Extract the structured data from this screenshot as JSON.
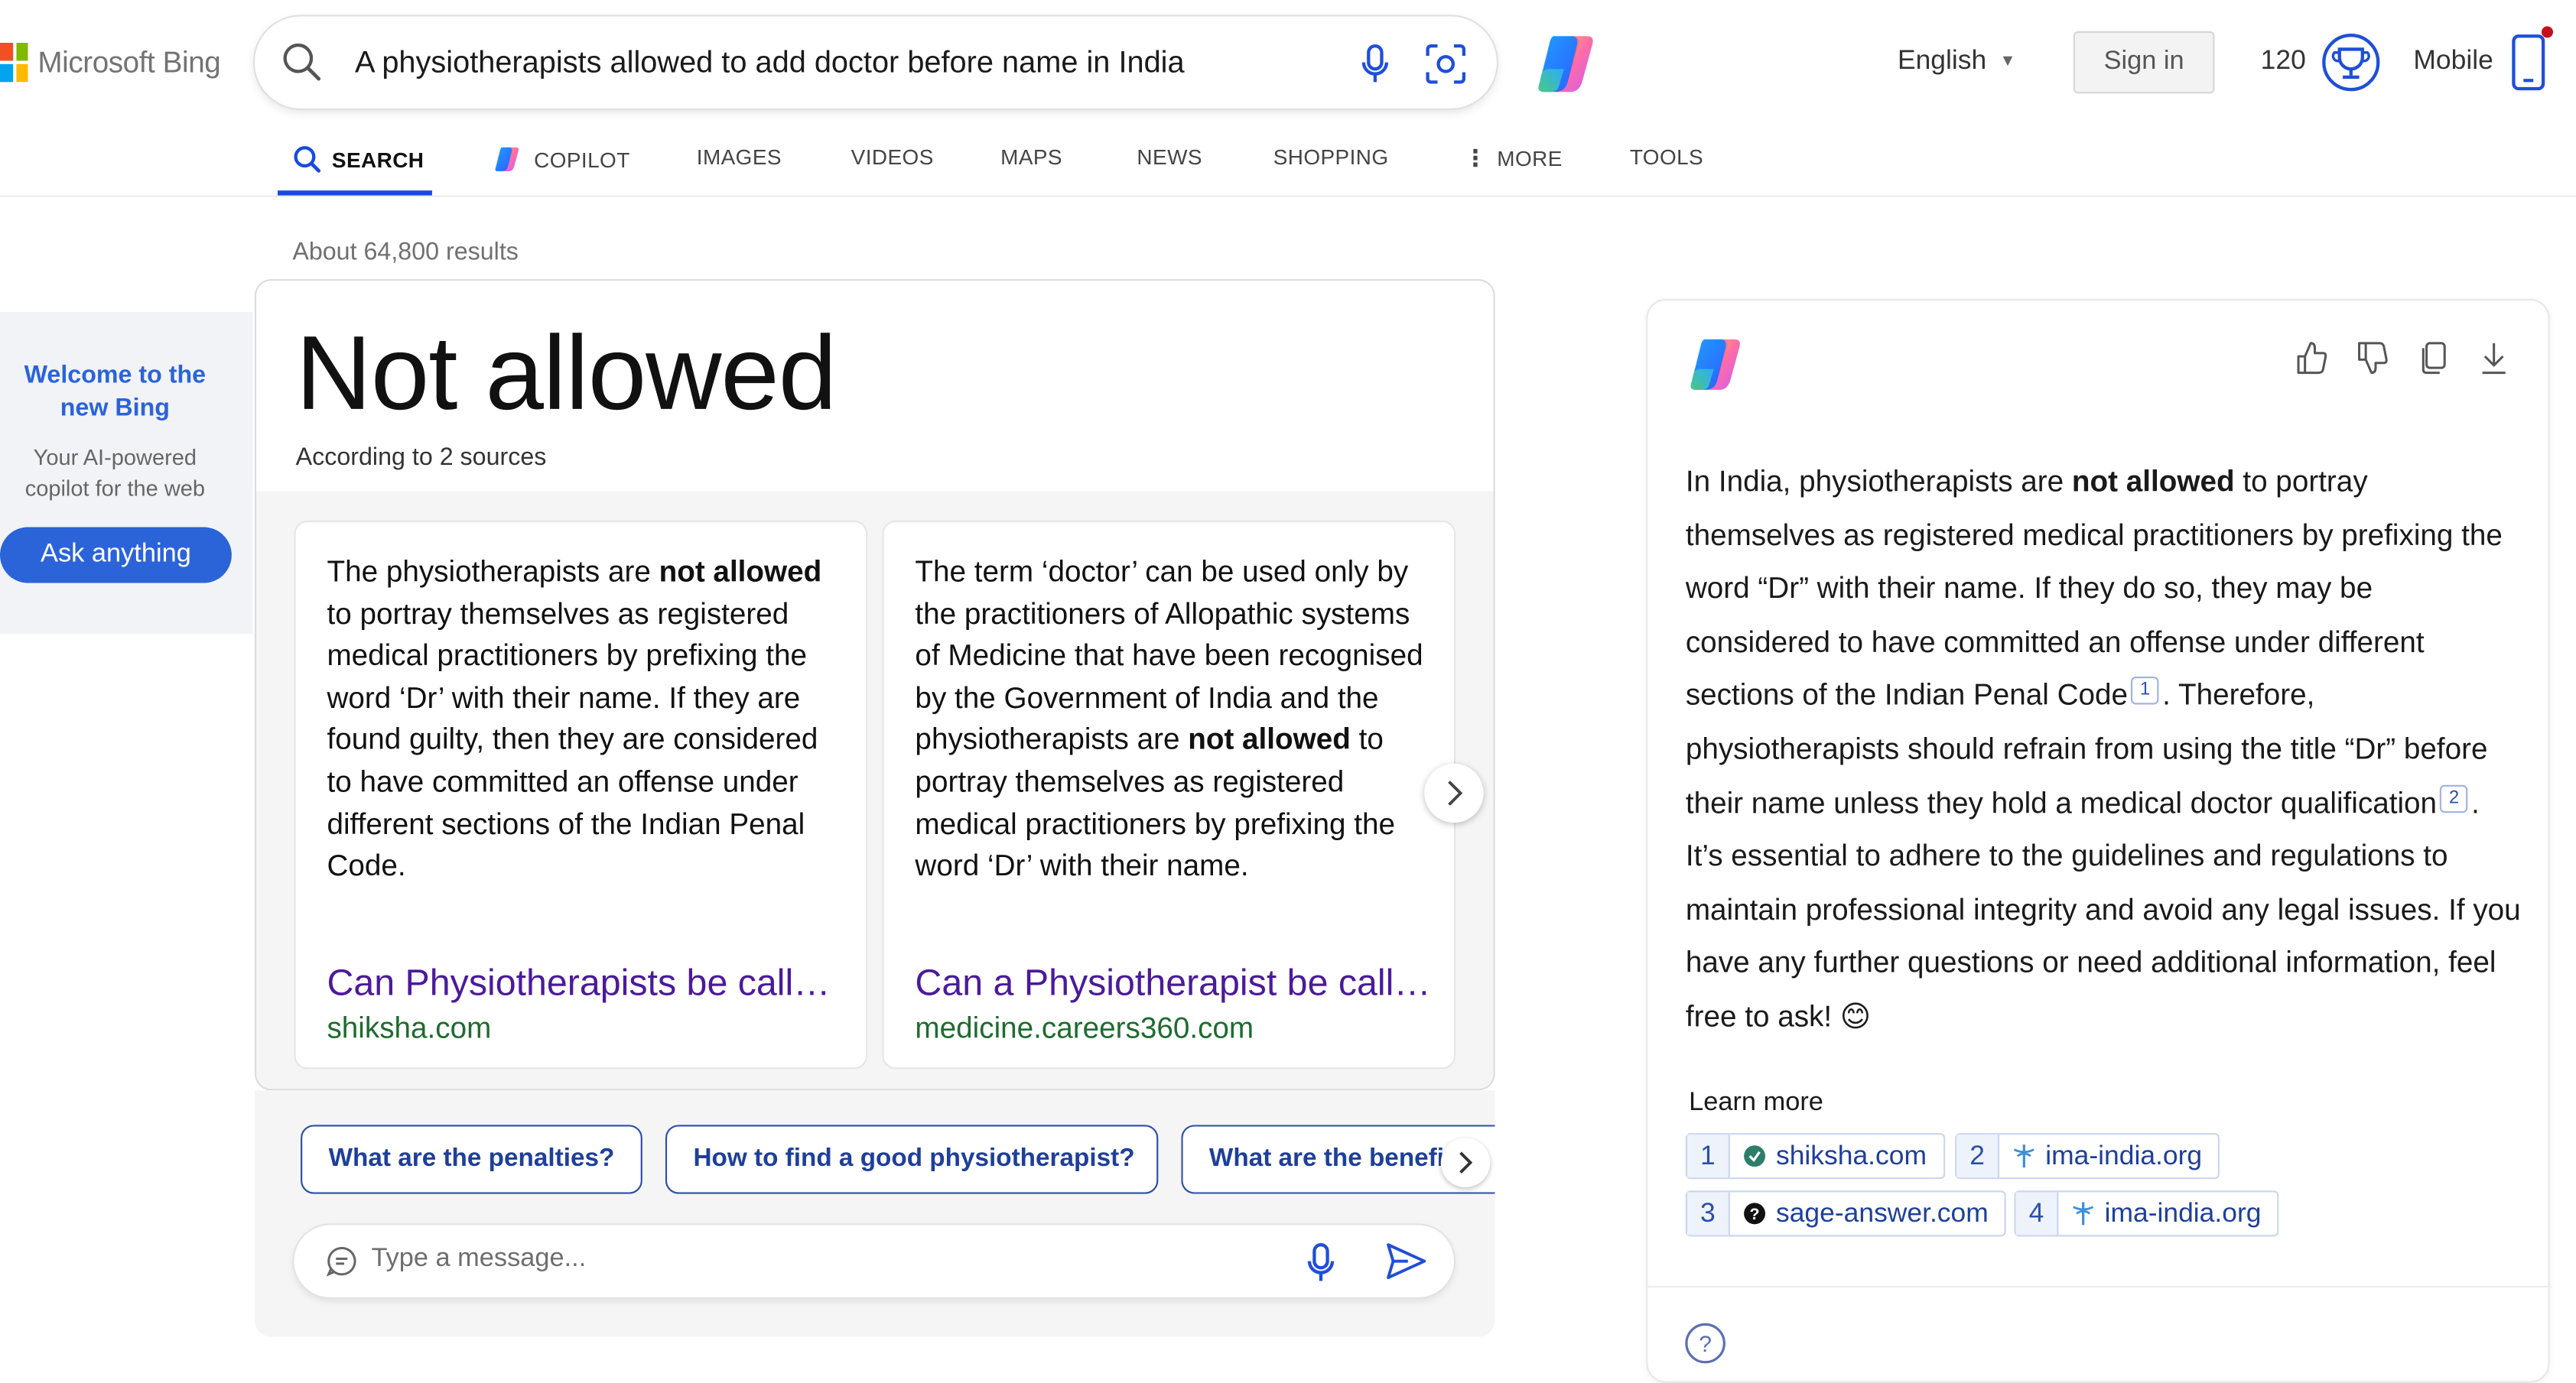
{
  "header": {
    "logo_text": "Microsoft Bing",
    "logo_colors": [
      "#f25022",
      "#7fba00",
      "#00a4ef",
      "#ffb900"
    ],
    "search_query": "A physiotherapists allowed to add doctor before name in India",
    "language": "English",
    "sign_in": "Sign in",
    "points": "120",
    "mobile": "Mobile"
  },
  "nav": {
    "items": [
      {
        "label": "SEARCH",
        "icon": "search-icon",
        "active": true
      },
      {
        "label": "COPILOT",
        "icon": "copilot-icon"
      },
      {
        "label": "IMAGES"
      },
      {
        "label": "VIDEOS"
      },
      {
        "label": "MAPS"
      },
      {
        "label": "NEWS"
      },
      {
        "label": "SHOPPING"
      },
      {
        "label": "MORE",
        "icon": "more-vertical-icon"
      },
      {
        "label": "TOOLS"
      }
    ],
    "accent": "#174ae4"
  },
  "results_count": "About 64,800 results",
  "welcome": {
    "title": "Welcome to the new Bing",
    "subtitle": "Your AI-powered copilot for the web",
    "button": "Ask anything"
  },
  "answer": {
    "headline": "Not allowed",
    "according": "According to 2 sources",
    "sources": [
      {
        "text_before": "The physiotherapists are ",
        "bold": "not allowed",
        "text_after": " to portray themselves as registered medical practitioners by prefixing the word ‘Dr’ with their name. If they are found guilty, then they are considered to have committed an offense under different sections of the Indian Penal Code.",
        "link": "Can Physiotherapists be called Doctors?",
        "domain": "shiksha.com"
      },
      {
        "text_before": "The term ‘doctor’ can be used only by the practitioners of Allopathic systems of Medicine that have been recognised by the Government of India and the physiotherapists are ",
        "bold": "not allowed",
        "text_after": " to portray themselves as registered medical practitioners by prefixing the word ‘Dr’ with their name.",
        "link": "Can a Physiotherapist be called Doctor?",
        "domain": "medicine.careers360.com"
      }
    ]
  },
  "followups": [
    "What are the penalties?",
    "How to find a good physiotherapist?",
    "What are the benefits"
  ],
  "message_placeholder": "Type a message...",
  "copilot_panel": {
    "segments": [
      {
        "t": "In India, physiotherapists are "
      },
      {
        "t": "not allowed",
        "b": true
      },
      {
        "t": " to portray themselves as registered medical practitioners by prefixing the word “Dr” with their name. If they do so, they may be considered to have committed an offense under different sections of the Indian Penal Code"
      },
      {
        "cite": "1"
      },
      {
        "t": ". Therefore, physiotherapists should refrain from using the title “Dr” before their name unless they hold a medical doctor qualification"
      },
      {
        "cite": "2"
      },
      {
        "t": ". It’s essential to adhere to the guidelines and regulations to maintain professional integrity and avoid any legal issues. If you have any further questions or need additional information, feel free to ask! 😊"
      }
    ],
    "learn_more": "Learn more",
    "references": [
      {
        "num": "1",
        "domain": "shiksha.com",
        "icon": "shiksha-favicon-icon"
      },
      {
        "num": "2",
        "domain": "ima-india.org",
        "icon": "caduceus-icon"
      },
      {
        "num": "3",
        "domain": "sage-answer.com",
        "icon": "question-circle-icon"
      },
      {
        "num": "4",
        "domain": "ima-india.org",
        "icon": "caduceus-icon"
      }
    ]
  }
}
